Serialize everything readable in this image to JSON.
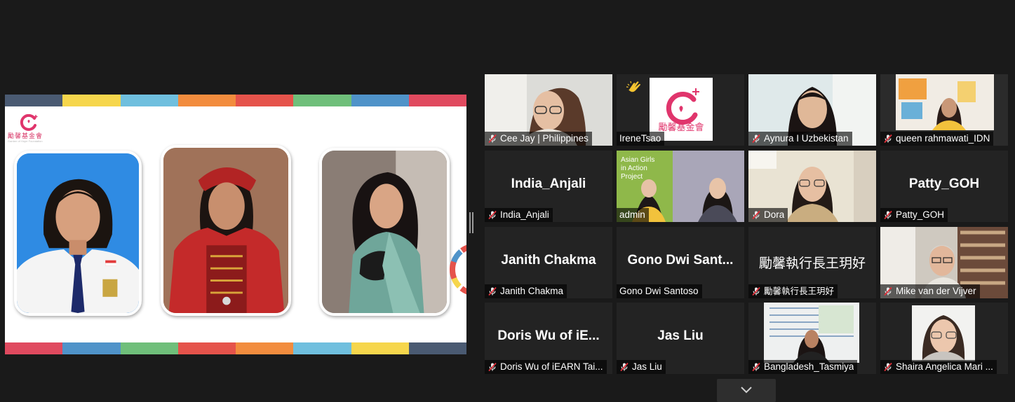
{
  "slide": {
    "logo_chinese": "勵馨基金會",
    "logo_english": "Garden of Hope Foundation",
    "stripe_colors": [
      "#4a5a72",
      "#f6d64c",
      "#6fbfde",
      "#f28c3e",
      "#e5534b",
      "#6fbf7a",
      "#4f93c9",
      "#e04a5f"
    ],
    "stripe_colors_bottom": [
      "#e04a5f",
      "#4f93c9",
      "#6fbf7a",
      "#e5534b",
      "#f28c3e",
      "#6fbfde",
      "#f6d64c",
      "#4a5a72"
    ],
    "brand_color": "#e0356c"
  },
  "gallery": {
    "active_speaker_color": "#c7e64f",
    "muted_icon": "mic-muted-icon",
    "tiles": [
      {
        "name": "Cee Jay | Philippines",
        "video": true,
        "muted": true
      },
      {
        "name": "IreneTsao",
        "video": true,
        "muted": false,
        "reaction": "clap-icon"
      },
      {
        "name": "Aynura I Uzbekistan",
        "video": true,
        "muted": true
      },
      {
        "name": "queen rahmawati_IDN",
        "video": true,
        "muted": true
      },
      {
        "name": "India_Anjali",
        "display": "India_Anjali",
        "video": false,
        "muted": true
      },
      {
        "name": "admin",
        "video": true,
        "muted": false,
        "speaking": true,
        "banner_text": "Asian Girls in Action Project"
      },
      {
        "name": "Dora",
        "video": true,
        "muted": true
      },
      {
        "name": "Patty_GOH",
        "display": "Patty_GOH",
        "video": false,
        "muted": true
      },
      {
        "name": "Janith Chakma",
        "display": "Janith Chakma",
        "video": false,
        "muted": true
      },
      {
        "name": "Gono Dwi Santoso",
        "display": "Gono  Dwi  Sant...",
        "video": false,
        "muted": false
      },
      {
        "name": "勵馨執行長王玥好",
        "display": "勵馨執行長王玥好",
        "video": false,
        "muted": true
      },
      {
        "name": "Mike van der Vijver",
        "video": true,
        "muted": true
      },
      {
        "name": "Doris Wu of  iEARN Tai...",
        "display": "Doris Wu of  iE...",
        "video": false,
        "muted": true
      },
      {
        "name": "Jas Liu",
        "display": "Jas Liu",
        "video": false,
        "muted": true
      },
      {
        "name": "Bangladesh_Tasmiya",
        "video": true,
        "muted": true
      },
      {
        "name": "Shaira Angelica Mari ...",
        "video": true,
        "muted": true
      }
    ]
  },
  "controls": {
    "scroll_down_icon": "chevron-down-icon"
  }
}
